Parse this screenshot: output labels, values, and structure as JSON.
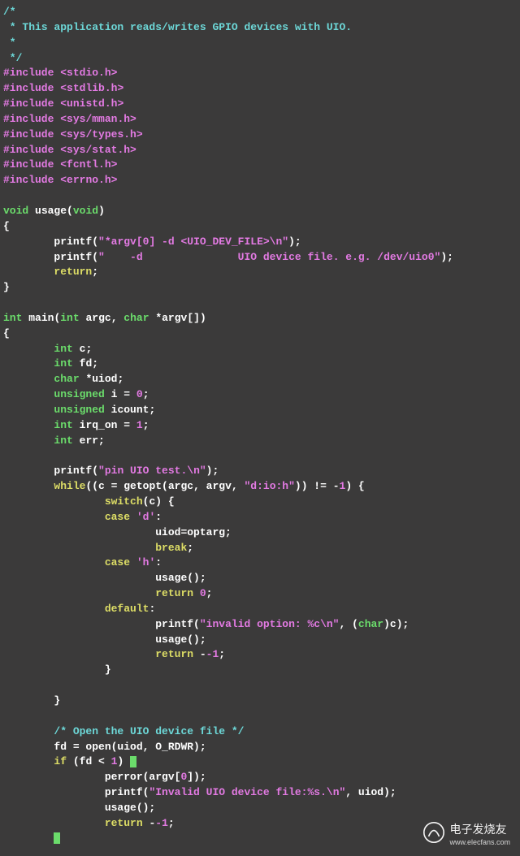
{
  "comment_block": {
    "l1": "/*",
    "l2": " * This application reads/writes GPIO devices with UIO.",
    "l3": " *",
    "l4": " */"
  },
  "includes": [
    {
      "kw": "#include",
      "hdr": "<stdio.h>"
    },
    {
      "kw": "#include",
      "hdr": "<stdlib.h>"
    },
    {
      "kw": "#include",
      "hdr": "<unistd.h>"
    },
    {
      "kw": "#include",
      "hdr": "<sys/mman.h>"
    },
    {
      "kw": "#include",
      "hdr": "<sys/types.h>"
    },
    {
      "kw": "#include",
      "hdr": "<sys/stat.h>"
    },
    {
      "kw": "#include",
      "hdr": "<fcntl.h>"
    },
    {
      "kw": "#include",
      "hdr": "<errno.h>"
    }
  ],
  "fn_usage": {
    "ret": "void",
    "name": "usage",
    "param_type": "void",
    "body": {
      "printf1": {
        "fn": "printf",
        "str": "\"*argv[0] -d <UIO_DEV_FILE>\\n\""
      },
      "printf2": {
        "fn": "printf",
        "str": "\"    -d               UIO device file. e.g. /dev/uio0\""
      },
      "ret": "return"
    }
  },
  "fn_main": {
    "ret": "int",
    "name": "main",
    "argc_t": "int",
    "argc_n": "argc",
    "argv_t": "char",
    "argv_n": "*argv[]",
    "decls": {
      "c": {
        "t": "int",
        "n": "c"
      },
      "fd": {
        "t": "int",
        "n": "fd"
      },
      "uiod": {
        "t": "char",
        "n": "*uiod"
      },
      "i": {
        "t": "unsigned",
        "n": "i",
        "eq": "=",
        "v": "0"
      },
      "icount": {
        "t": "unsigned",
        "n": "icount"
      },
      "irq": {
        "t": "int",
        "n": "irq_on",
        "eq": "=",
        "v": "1"
      },
      "err": {
        "t": "int",
        "n": "err"
      }
    },
    "printf_start": {
      "fn": "printf",
      "str": "\"pin UIO test.\\n\""
    },
    "while": {
      "kw": "while",
      "cond_pre": "((c = getopt(argc, argv, ",
      "cond_str": "\"d:io:h\"",
      "cond_post": ")) != -",
      "cond_num": "1",
      "cond_close": ") {"
    },
    "switch": {
      "kw": "switch",
      "cond": "(c) {",
      "case_d": {
        "kw": "case",
        "val": "'d'",
        "body": "uiod=optarg;",
        "brk": "break"
      },
      "case_h": {
        "kw": "case",
        "val": "'h'",
        "body": "usage();",
        "ret": "return",
        "rv": "0"
      },
      "default": {
        "kw": "default",
        "printf": {
          "fn": "printf",
          "str": "\"invalid option: %c\\n\"",
          "cast_t": "char",
          "cast_rest": ")c);"
        },
        "usage": "usage();",
        "ret": "return",
        "rv": "-1"
      }
    },
    "open_comment": "/* Open the UIO device file */",
    "open_line": "fd = open(uiod, O_RDWR);",
    "if": {
      "kw": "if",
      "cond": "(fd < ",
      "num": "1",
      "close": ") ",
      "brace": "{",
      "perror": "perror(argv[",
      "pz": "0",
      "perror2": "]);",
      "printf": {
        "fn": "printf",
        "str": "\"Invalid UIO device file:%s.\\n\"",
        "rest": ", uiod);"
      },
      "usage": "usage();",
      "ret": "return",
      "rv": "-1"
    }
  },
  "watermark": {
    "title": "电子发烧友",
    "sub": "www.elecfans.com"
  }
}
